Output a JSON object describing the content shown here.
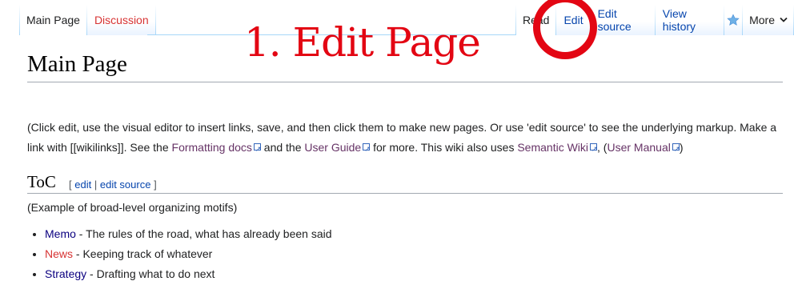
{
  "tabs_left": [
    {
      "label": "Main Page",
      "state": "selected"
    },
    {
      "label": "Discussion",
      "state": "new"
    }
  ],
  "tabs_right": {
    "read": "Read",
    "edit": "Edit",
    "edit_source": "Edit source",
    "view_history": "View history",
    "watch_icon": "star-icon",
    "more": "More",
    "more_icon": "chevron-down-icon"
  },
  "annotation": {
    "text": "1. Edit Page",
    "color": "#e30613"
  },
  "page_title": "Main Page",
  "intro": {
    "text1": "(Click edit, use the visual editor to insert links, save, and then click them to make new pages. Or use 'edit source' to see the underlying markup. Make a link with [[wikilinks]]. See the ",
    "link1": "Formatting docs",
    "text2": " and the ",
    "link2": "User Guide",
    "text3": " for more. This wiki also uses ",
    "link3": "Semantic Wiki",
    "text4": ", (",
    "link4": "User Manual",
    "text5": ")"
  },
  "section": {
    "heading": "ToC",
    "bracket_open": "[",
    "edit": "edit",
    "separator": "|",
    "edit_source": "edit source",
    "bracket_close": "]",
    "paragraph": "(Example of broad-level organizing motifs)",
    "items": [
      {
        "link": "Memo",
        "text": " - The rules of the road, what has already been said",
        "state": "visited"
      },
      {
        "link": "News",
        "text": " - Keeping track of whatever",
        "state": "new"
      },
      {
        "link": "Strategy",
        "text": " - Drafting what to do next",
        "state": "visited"
      }
    ]
  },
  "colors": {
    "link": "#0645ad",
    "new_link": "#d73333",
    "external_visited": "#663366",
    "annotation": "#e30613"
  }
}
